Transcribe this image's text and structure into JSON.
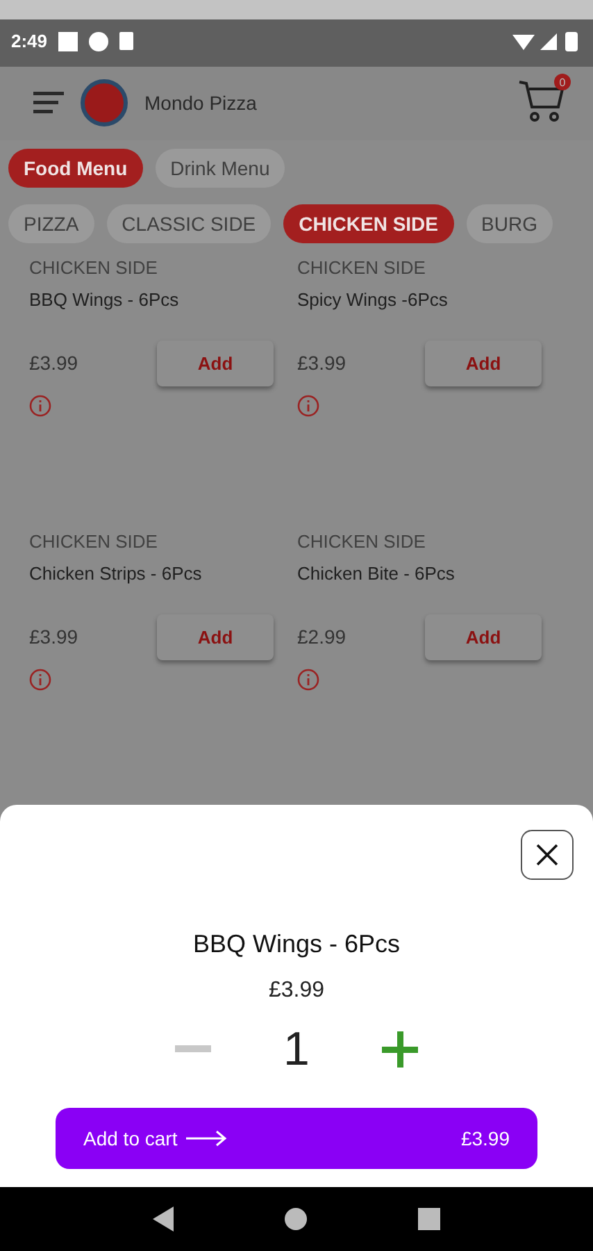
{
  "status_bar": {
    "time": "2:49"
  },
  "header": {
    "title": "Mondo Pizza",
    "cart_count": "0"
  },
  "menu_tabs": [
    {
      "label": "Food Menu",
      "selected": true
    },
    {
      "label": "Drink Menu",
      "selected": false
    }
  ],
  "categories": [
    {
      "label": "PIZZA",
      "selected": false
    },
    {
      "label": "CLASSIC SIDE",
      "selected": false
    },
    {
      "label": "CHICKEN SIDE",
      "selected": true
    },
    {
      "label": "BURG",
      "selected": false
    }
  ],
  "products": [
    {
      "category": "CHICKEN SIDE",
      "name": "BBQ Wings - 6Pcs",
      "price": "£3.99",
      "button": "Add"
    },
    {
      "category": "CHICKEN SIDE",
      "name": "Spicy Wings -6Pcs",
      "price": "£3.99",
      "button": "Add"
    },
    {
      "category": "CHICKEN SIDE",
      "name": "Chicken Strips - 6Pcs",
      "price": "£3.99",
      "button": "Add"
    },
    {
      "category": "CHICKEN SIDE",
      "name": "Chicken Bite - 6Pcs",
      "price": "£2.99",
      "button": "Add"
    }
  ],
  "sheet": {
    "title": "BBQ Wings - 6Pcs",
    "price": "£3.99",
    "quantity": "1",
    "cart_button": {
      "label": "Add to cart",
      "total": "£3.99"
    }
  }
}
